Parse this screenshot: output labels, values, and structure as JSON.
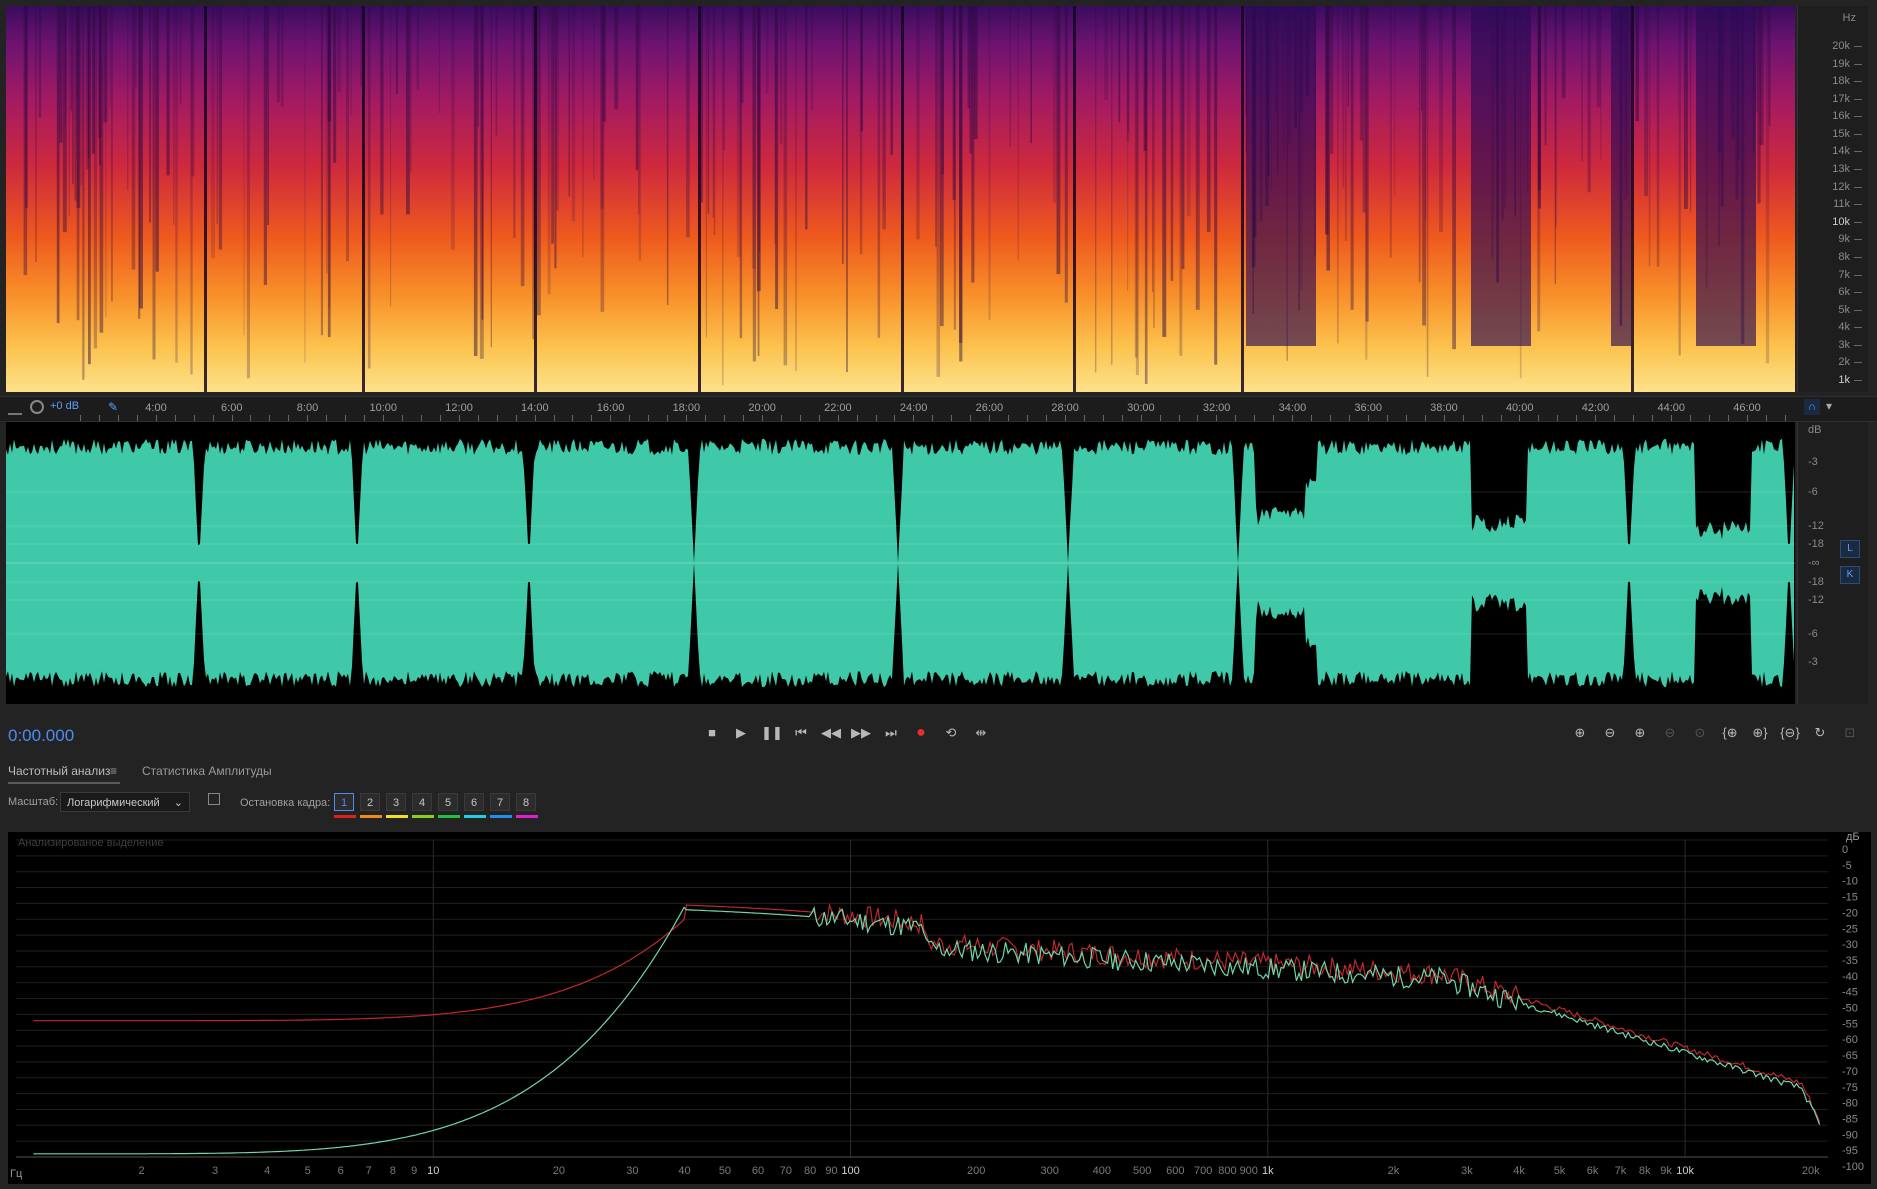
{
  "spectrogram": {
    "hz_unit": "Hz",
    "hz_labels": [
      "20k",
      "19k",
      "18k",
      "17k",
      "16k",
      "15k",
      "14k",
      "13k",
      "12k",
      "11k",
      "10k",
      "9k",
      "8k",
      "7k",
      "6k",
      "5k",
      "4k",
      "3k",
      "2k",
      "1k"
    ]
  },
  "timeline": {
    "gain_label": "+0 dB",
    "labels": [
      "4:00",
      "6:00",
      "8:00",
      "10:00",
      "12:00",
      "14:00",
      "16:00",
      "18:00",
      "20:00",
      "22:00",
      "24:00",
      "26:00",
      "28:00",
      "30:00",
      "32:00",
      "34:00",
      "36:00",
      "38:00",
      "40:00",
      "42:00",
      "44:00",
      "46:00"
    ]
  },
  "waveform": {
    "db_unit": "dB",
    "db_labels": [
      "-3",
      "-6",
      "-12",
      "-18",
      "-∞",
      "-18",
      "-12",
      "-6",
      "-3"
    ],
    "channel_left": "L",
    "channel_right": "K",
    "colors": {
      "wave": "#3fc9a8",
      "background": "#000000"
    }
  },
  "transport": {
    "timecode": "0:00.000",
    "buttons": [
      "stop-icon",
      "play-icon",
      "pause-icon",
      "go-start-icon",
      "rewind-icon",
      "fast-forward-icon",
      "go-end-icon",
      "record-icon",
      "loop-icon",
      "skip-selection-icon"
    ],
    "zoom_buttons": [
      "zoom-in-amplitude-icon",
      "zoom-out-amplitude-icon",
      "zoom-in-time-icon",
      "zoom-out-time-icon",
      "zoom-selection-icon",
      "zoom-in-left-icon",
      "zoom-in-right-icon",
      "zoom-out-full-icon",
      "zoom-reset-icon",
      "zoom-fit-icon"
    ]
  },
  "analysis_panel": {
    "tab_frequency": "Частотный анализ",
    "tab_amplitude": "Статистика Амплитуды",
    "scale_label": "Масштаб:",
    "scale_value": "Логарифмический",
    "freeze_label": "Остановка кадра:",
    "frames": [
      "1",
      "2",
      "3",
      "4",
      "5",
      "6",
      "7",
      "8"
    ],
    "frame_colors": [
      "#e02020",
      "#f08a1a",
      "#f0e020",
      "#8ad020",
      "#20c040",
      "#20d0e0",
      "#2090f0",
      "#e020d0"
    ],
    "plot_caption": "Анализированое выделение",
    "x_unit": "Гц",
    "x_labels": [
      "2",
      "3",
      "4",
      "5",
      "6",
      "7",
      "8",
      "9",
      "10",
      "20",
      "30",
      "40",
      "50",
      "60",
      "70",
      "80",
      "90",
      "100",
      "200",
      "300",
      "400",
      "500",
      "600",
      "700",
      "800",
      "900",
      "1k",
      "2k",
      "3k",
      "4k",
      "5k",
      "6k",
      "7k",
      "8k",
      "9k",
      "10k",
      "20k"
    ],
    "y_unit": "дБ",
    "y_labels": [
      "0",
      "-5",
      "-10",
      "-15",
      "-20",
      "-25",
      "-30",
      "-35",
      "-40",
      "-45",
      "-50",
      "-55",
      "-60",
      "-65",
      "-70",
      "-75",
      "-80",
      "-85",
      "-90",
      "-95",
      "-100"
    ],
    "series_colors": {
      "red": "#c0282a",
      "green": "#6fd7a8"
    }
  }
}
